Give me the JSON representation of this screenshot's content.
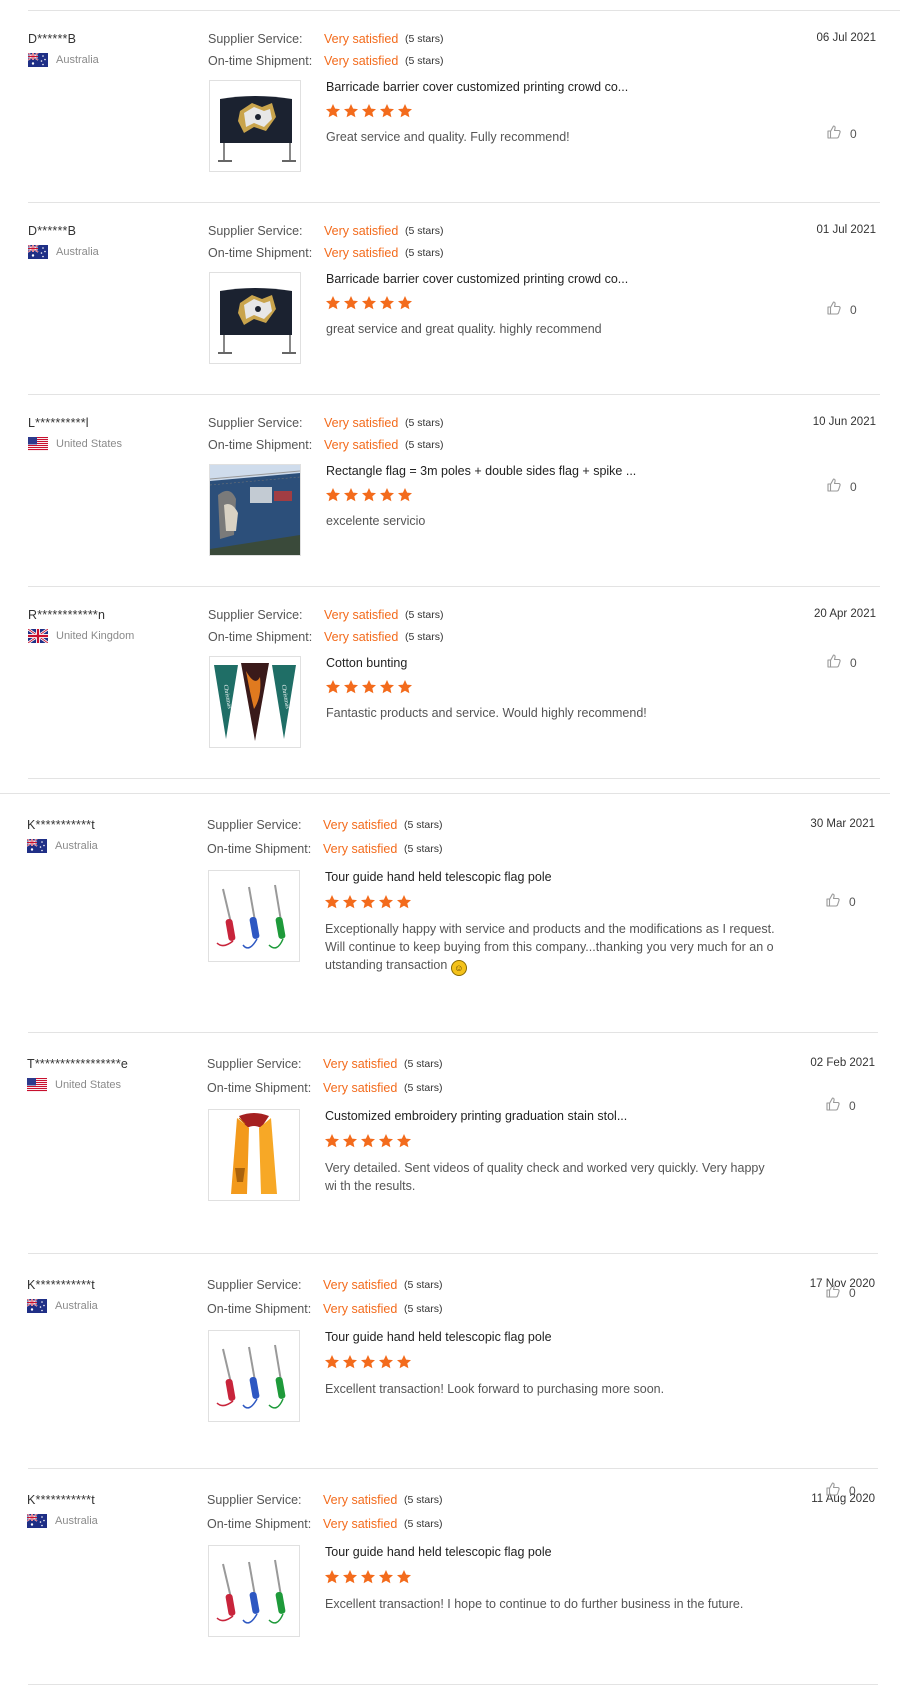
{
  "rating_labels": {
    "supplier": "Supplier Service:",
    "shipment": "On-time Shipment:"
  },
  "reviews": [
    {
      "user": "D******B",
      "country": "Australia",
      "flag": "au",
      "date": "06 Jul 2021",
      "supplier_value": "Very satisfied",
      "supplier_stars": "(5 stars)",
      "shipment_value": "Very satisfied",
      "shipment_stars": "(5 stars)",
      "product": "Barricade barrier cover customized printing crowd co...",
      "stars": 5,
      "comment": "Great service and quality. Fully recommend!",
      "likes": "0",
      "image": "barricade-cover"
    },
    {
      "user": "D******B",
      "country": "Australia",
      "flag": "au",
      "date": "01 Jul 2021",
      "supplier_value": "Very satisfied",
      "supplier_stars": "(5 stars)",
      "shipment_value": "Very satisfied",
      "shipment_stars": "(5 stars)",
      "product": "Barricade barrier cover customized printing crowd co...",
      "stars": 5,
      "comment": "great service and great quality. highly recommend",
      "likes": "0",
      "image": "barricade-cover"
    },
    {
      "user": "L**********l",
      "country": "United States",
      "flag": "us",
      "date": "10 Jun 2021",
      "supplier_value": "Very satisfied",
      "supplier_stars": "(5 stars)",
      "shipment_value": "Very satisfied",
      "shipment_stars": "(5 stars)",
      "product": "Rectangle flag = 3m poles + double sides flag + spike ...",
      "stars": 5,
      "comment": "excelente servicio",
      "likes": "0",
      "image": "fence-banner"
    },
    {
      "user": "R************n",
      "country": "United Kingdom",
      "flag": "gb",
      "date": "20 Apr 2021",
      "supplier_value": "Very satisfied",
      "supplier_stars": "(5 stars)",
      "shipment_value": "Very satisfied",
      "shipment_stars": "(5 stars)",
      "product": "Cotton bunting",
      "stars": 5,
      "comment": "Fantastic products and service. Would highly recommend!",
      "likes": "0",
      "image": "pennants"
    },
    {
      "user": "K***********t",
      "country": "Australia",
      "flag": "au",
      "date": "30 Mar 2021",
      "supplier_value": "Very satisfied",
      "supplier_stars": "(5 stars)",
      "shipment_value": "Very satisfied",
      "shipment_stars": "(5 stars)",
      "product": "Tour guide hand held telescopic flag pole",
      "stars": 5,
      "comment": "Exceptionally happy with service and products and the modifications as I request. Will continue to keep buying from this company...thanking you very much for an o utstanding transaction",
      "likes": "0",
      "image": "telescopic-poles",
      "emoji": true
    },
    {
      "user": "T*****************e",
      "country": "United States",
      "flag": "us",
      "date": "02 Feb 2021",
      "supplier_value": "Very satisfied",
      "supplier_stars": "(5 stars)",
      "shipment_value": "Very satisfied",
      "shipment_stars": "(5 stars)",
      "product": "Customized embroidery printing graduation stain stol...",
      "stars": 5,
      "comment": "Very detailed. Sent videos of quality check and worked very quickly. Very happy wi th the results.",
      "likes": "0",
      "image": "graduation-stole"
    },
    {
      "user": "K***********t",
      "country": "Australia",
      "flag": "au",
      "date": "17 Nov 2020",
      "supplier_value": "Very satisfied",
      "supplier_stars": "(5 stars)",
      "shipment_value": "Very satisfied",
      "shipment_stars": "(5 stars)",
      "product": "Tour guide hand held telescopic flag pole",
      "stars": 5,
      "comment": "Excellent transaction! Look forward to purchasing more soon.",
      "likes": "0",
      "image": "telescopic-poles"
    },
    {
      "user": "K***********t",
      "country": "Australia",
      "flag": "au",
      "date": "11 Aug 2020",
      "supplier_value": "Very satisfied",
      "supplier_stars": "(5 stars)",
      "shipment_value": "Very satisfied",
      "shipment_stars": "(5 stars)",
      "product": "Tour guide hand held telescopic flag pole",
      "stars": 5,
      "comment": "Excellent transaction! I hope to continue to do further business in the future.",
      "likes": "0",
      "image": "telescopic-poles"
    }
  ],
  "colors": {
    "accent": "#f36b1c",
    "star": "#f36b1c",
    "divider": "#e3e3e3"
  }
}
